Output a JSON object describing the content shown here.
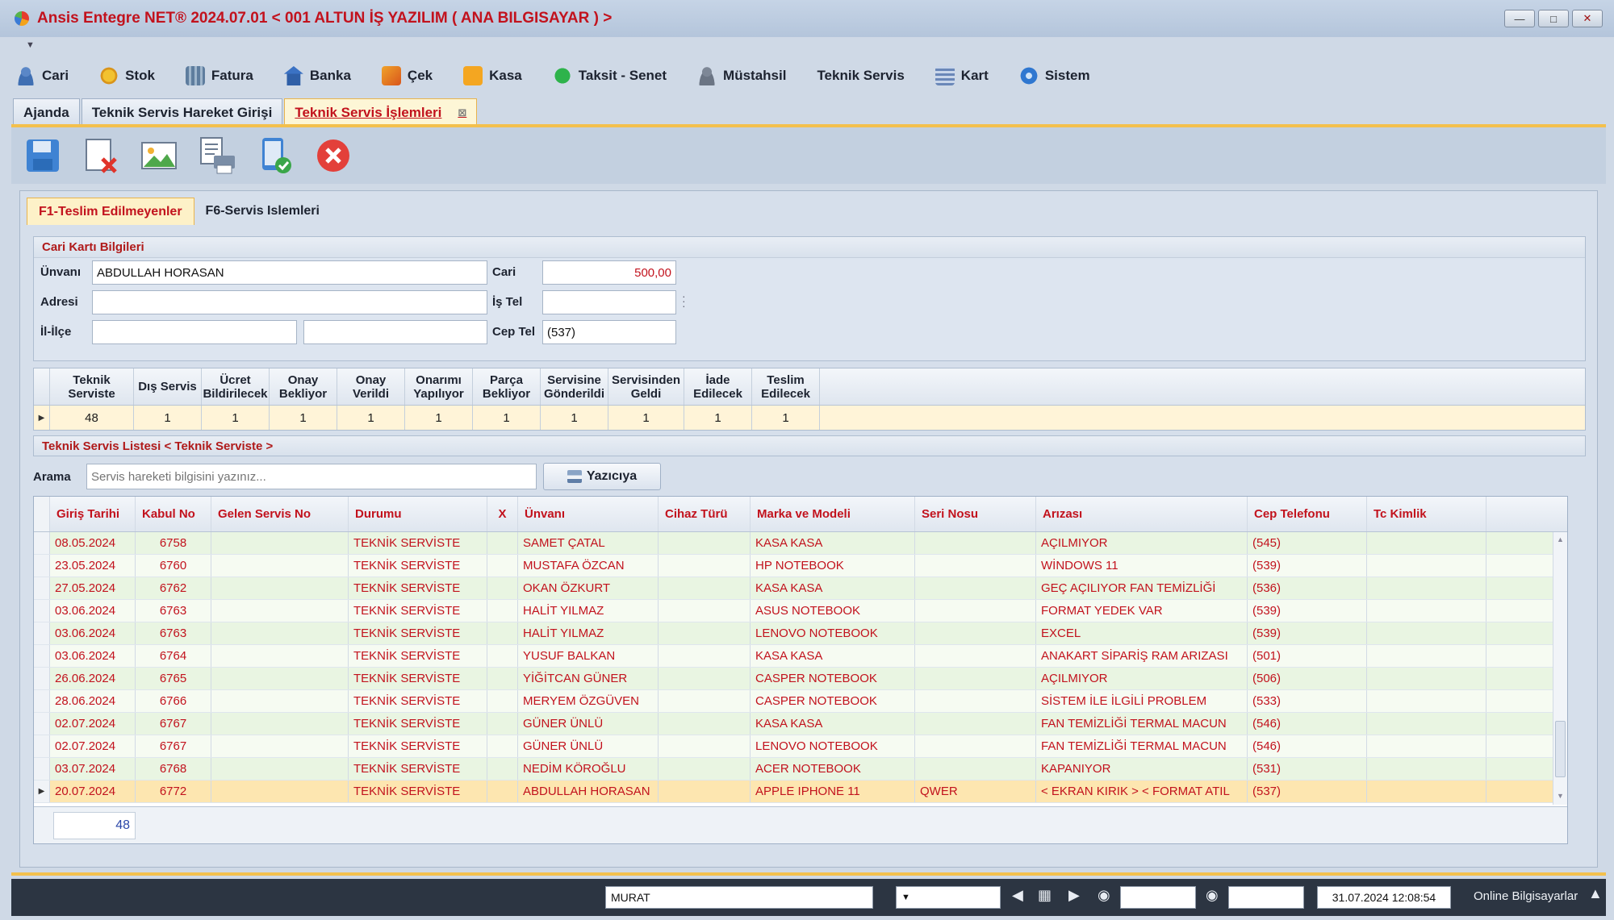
{
  "window": {
    "title": "Ansis Entegre NET® 2024.07.01  < 001 ALTUN İŞ YAZILIM ( ANA BILGISAYAR ) >"
  },
  "menu": [
    {
      "label": "Cari",
      "icon": "person-icon",
      "cls": "ic-cari"
    },
    {
      "label": "Stok",
      "icon": "coins-icon",
      "cls": "ic-stok"
    },
    {
      "label": "Fatura",
      "icon": "invoice-icon",
      "cls": "ic-fatura"
    },
    {
      "label": "Banka",
      "icon": "bank-icon",
      "cls": "ic-banka"
    },
    {
      "label": "Çek",
      "icon": "cheque-icon",
      "cls": "ic-cek"
    },
    {
      "label": "Kasa",
      "icon": "cashbox-icon",
      "cls": "ic-kasa"
    },
    {
      "label": "Taksit - Senet",
      "icon": "installment-icon",
      "cls": "ic-taksit"
    },
    {
      "label": "Müstahsil",
      "icon": "farmer-icon",
      "cls": "ic-mustahsil"
    },
    {
      "label": "Teknik Servis",
      "icon": "",
      "cls": ""
    },
    {
      "label": "Kart",
      "icon": "card-icon",
      "cls": "ic-kart"
    },
    {
      "label": "Sistem",
      "icon": "gear-icon",
      "cls": "ic-sistem"
    }
  ],
  "doc_tabs": [
    "Ajanda",
    "Teknik Servis Hareket Girişi",
    "Teknik Servis İşlemleri"
  ],
  "inner_tabs": [
    "F1-Teslim Edilmeyenler",
    "F6-Servis Islemleri"
  ],
  "cari": {
    "title": "Cari Kartı Bilgileri",
    "unvan_label": "Ünvanı",
    "unvan": "ABDULLAH HORASAN",
    "adres_label": "Adresi",
    "adres": "",
    "ililce_label": "İl-İlçe",
    "il": "",
    "ilce": "",
    "cari_label": "Cari",
    "cari": "500,00",
    "istel_label": "İş Tel",
    "istel": "",
    "ceptel_label": "Cep Tel",
    "ceptel": "(537)"
  },
  "summary": {
    "headers": [
      "Teknik\nServiste",
      "Dış Servis",
      "Ücret\nBildirilecek",
      "Onay\nBekliyor",
      "Onay Verildi",
      "Onarımı\nYapılıyor",
      "Parça\nBekliyor",
      "Servisine\nGönderildi",
      "Servisinden\nGeldi",
      "İade\nEdilecek",
      "Teslim\nEdilecek"
    ],
    "values": [
      "48",
      "1",
      "1",
      "1",
      "1",
      "1",
      "1",
      "1",
      "1",
      "1",
      "1"
    ]
  },
  "list": {
    "title": "Teknik Servis Listesi < Teknik Serviste >",
    "search_label": "Arama",
    "search_placeholder": "Servis hareketi bilgisini yazınız...",
    "print_button": "Yazıcıya",
    "columns": [
      "Giriş Tarihi",
      "Kabul No",
      "Gelen Servis No",
      "Durumu",
      "X",
      "Ünvanı",
      "Cihaz Türü",
      "Marka ve Modeli",
      "Seri Nosu",
      "Arızası",
      "Cep Telefonu",
      "Tc Kimlik"
    ],
    "rows": [
      [
        "08.05.2024",
        "6758",
        "",
        "TEKNİK SERVİSTE",
        "",
        "SAMET ÇATAL",
        "",
        "KASA KASA",
        "",
        "AÇILMIYOR",
        "(545)",
        ""
      ],
      [
        "23.05.2024",
        "6760",
        "",
        "TEKNİK SERVİSTE",
        "",
        "MUSTAFA ÖZCAN",
        "",
        "HP NOTEBOOK",
        "",
        "WİNDOWS 11",
        "(539)",
        ""
      ],
      [
        "27.05.2024",
        "6762",
        "",
        "TEKNİK SERVİSTE",
        "",
        "OKAN ÖZKURT",
        "",
        "KASA KASA",
        "",
        "GEÇ AÇILIYOR FAN TEMİZLİĞİ",
        "(536)",
        ""
      ],
      [
        "03.06.2024",
        "6763",
        "",
        "TEKNİK SERVİSTE",
        "",
        "HALİT YILMAZ",
        "",
        "ASUS NOTEBOOK",
        "",
        "FORMAT YEDEK VAR",
        "(539)",
        ""
      ],
      [
        "03.06.2024",
        "6763",
        "",
        "TEKNİK SERVİSTE",
        "",
        "HALİT YILMAZ",
        "",
        "LENOVO NOTEBOOK",
        "",
        "EXCEL",
        "(539)",
        ""
      ],
      [
        "03.06.2024",
        "6764",
        "",
        "TEKNİK SERVİSTE",
        "",
        "YUSUF BALKAN",
        "",
        "KASA KASA",
        "",
        "ANAKART SİPARİŞ RAM ARIZASI",
        "(501)",
        ""
      ],
      [
        "26.06.2024",
        "6765",
        "",
        "TEKNİK SERVİSTE",
        "",
        "YİĞİTCAN GÜNER",
        "",
        "CASPER NOTEBOOK",
        "",
        "AÇILMIYOR",
        "(506)",
        ""
      ],
      [
        "28.06.2024",
        "6766",
        "",
        "TEKNİK SERVİSTE",
        "",
        "MERYEM ÖZGÜVEN",
        "",
        "CASPER NOTEBOOK",
        "",
        "SİSTEM İLE İLGİLİ PROBLEM",
        "(533)",
        ""
      ],
      [
        "02.07.2024",
        "6767",
        "",
        "TEKNİK SERVİSTE",
        "",
        "GÜNER ÜNLÜ",
        "",
        "KASA KASA",
        "",
        "FAN TEMİZLİĞİ TERMAL MACUN",
        "(546)",
        ""
      ],
      [
        "02.07.2024",
        "6767",
        "",
        "TEKNİK SERVİSTE",
        "",
        "GÜNER ÜNLÜ",
        "",
        "LENOVO NOTEBOOK",
        "",
        "FAN TEMİZLİĞİ TERMAL MACUN",
        "(546)",
        ""
      ],
      [
        "03.07.2024",
        "6768",
        "",
        "TEKNİK SERVİSTE",
        "",
        "NEDİM KÖROĞLU",
        "",
        "ACER NOTEBOOK",
        "",
        "KAPANIYOR",
        "(531)",
        ""
      ],
      [
        "20.07.2024",
        "6772",
        "",
        "TEKNİK SERVİSTE",
        "",
        "ABDULLAH HORASAN",
        "",
        "APPLE IPHONE 11",
        "QWER",
        "< EKRAN KIRIK > < FORMAT ATIL",
        "(537)",
        ""
      ]
    ],
    "selected_row": 11,
    "count": "48"
  },
  "status": {
    "user": "MURAT",
    "datetime": "31.07.2024 12:08:54",
    "online": "Online Bilgisayarlar"
  }
}
